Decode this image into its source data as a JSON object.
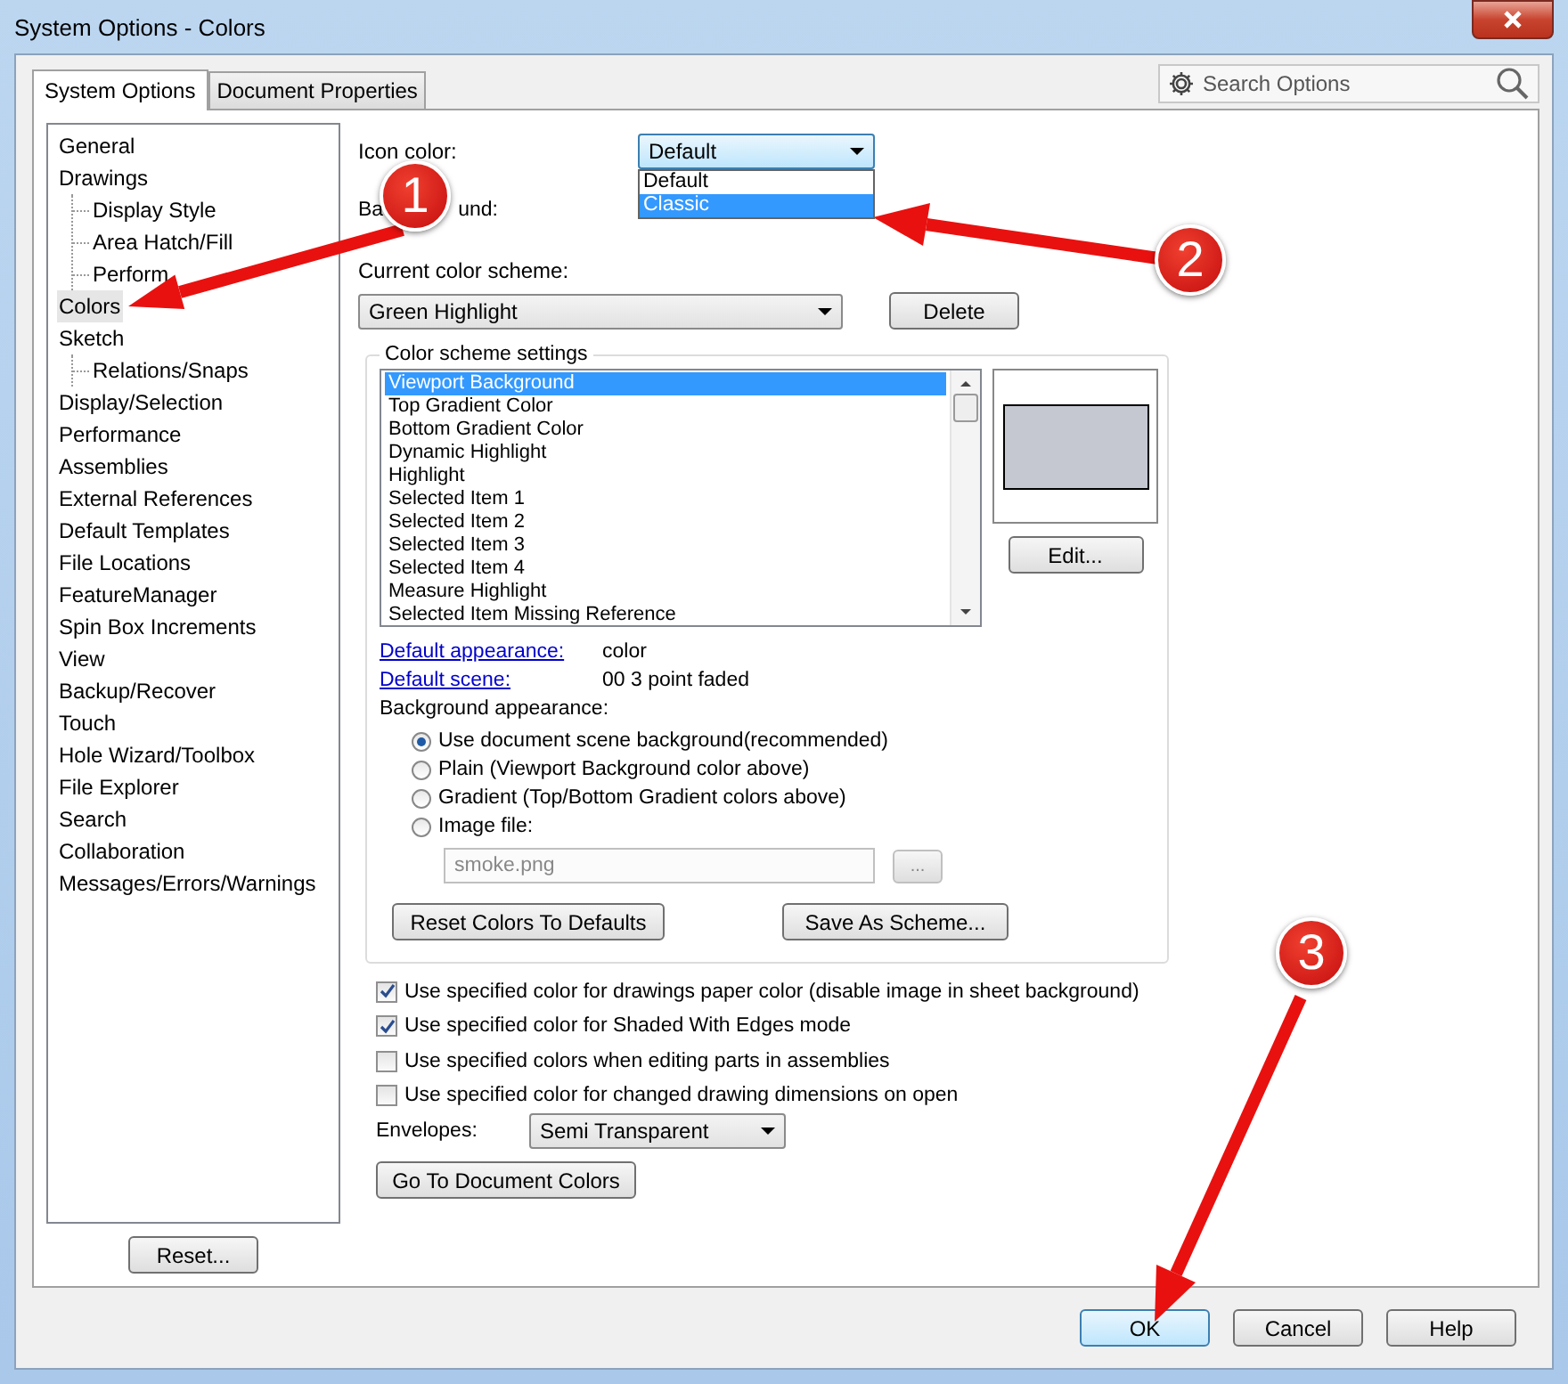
{
  "window": {
    "title": "System Options - Colors"
  },
  "tabs": [
    {
      "label": "System Options",
      "selected": true
    },
    {
      "label": "Document Properties",
      "selected": false
    }
  ],
  "search": {
    "placeholder": "Search Options"
  },
  "tree": [
    {
      "label": "General",
      "selected": false
    },
    {
      "label": "Drawings",
      "selected": false,
      "children": [
        {
          "label": "Display Style",
          "selected": false
        },
        {
          "label": "Area Hatch/Fill",
          "selected": false
        },
        {
          "label": "Perform",
          "selected": false
        }
      ]
    },
    {
      "label": "Colors",
      "selected": true
    },
    {
      "label": "Sketch",
      "selected": false,
      "children": [
        {
          "label": "Relations/Snaps",
          "selected": false
        }
      ]
    },
    {
      "label": "Display/Selection",
      "selected": false
    },
    {
      "label": "Performance",
      "selected": false
    },
    {
      "label": "Assemblies",
      "selected": false
    },
    {
      "label": "External References",
      "selected": false
    },
    {
      "label": "Default Templates",
      "selected": false
    },
    {
      "label": "File Locations",
      "selected": false
    },
    {
      "label": "FeatureManager",
      "selected": false
    },
    {
      "label": "Spin Box Increments",
      "selected": false
    },
    {
      "label": "View",
      "selected": false
    },
    {
      "label": "Backup/Recover",
      "selected": false
    },
    {
      "label": "Touch",
      "selected": false
    },
    {
      "label": "Hole Wizard/Toolbox",
      "selected": false
    },
    {
      "label": "File Explorer",
      "selected": false
    },
    {
      "label": "Search",
      "selected": false
    },
    {
      "label": "Collaboration",
      "selected": false
    },
    {
      "label": "Messages/Errors/Warnings",
      "selected": false
    }
  ],
  "reset_button": "Reset...",
  "icon_color": {
    "label": "Icon color:",
    "value": "Default",
    "options": [
      {
        "label": "Default",
        "highlighted": false
      },
      {
        "label": "Classic",
        "highlighted": true
      }
    ]
  },
  "background": {
    "label_parts": [
      "Ba",
      "und:"
    ]
  },
  "color_scheme": {
    "label": "Current color scheme:",
    "value": "Green Highlight",
    "delete_button": "Delete"
  },
  "scheme_settings": {
    "title": "Color scheme settings",
    "items": [
      {
        "label": "Viewport Background",
        "selected": true
      },
      {
        "label": "Top Gradient Color",
        "selected": false
      },
      {
        "label": "Bottom Gradient Color",
        "selected": false
      },
      {
        "label": "Dynamic Highlight",
        "selected": false
      },
      {
        "label": "Highlight",
        "selected": false
      },
      {
        "label": "Selected Item 1",
        "selected": false
      },
      {
        "label": "Selected Item 2",
        "selected": false
      },
      {
        "label": "Selected Item 3",
        "selected": false
      },
      {
        "label": "Selected Item 4",
        "selected": false
      },
      {
        "label": "Measure Highlight",
        "selected": false
      },
      {
        "label": "Selected Item Missing Reference",
        "selected": false
      }
    ],
    "edit_button": "Edit...",
    "default_appearance": {
      "link": "Default appearance:",
      "value": "color"
    },
    "default_scene": {
      "link": "Default scene:",
      "value": "00 3 point faded"
    },
    "background_appearance": {
      "label": "Background appearance:",
      "options": [
        {
          "label": "Use document scene background(recommended)",
          "selected": true
        },
        {
          "label": "Plain (Viewport Background color above)",
          "selected": false
        },
        {
          "label": "Gradient (Top/Bottom Gradient colors above)",
          "selected": false
        },
        {
          "label": "Image file:",
          "selected": false
        }
      ]
    },
    "image_file": {
      "value": "smoke.png",
      "disabled": true,
      "browse_button": "..."
    },
    "reset_colors_button": "Reset Colors To Defaults",
    "save_scheme_button": "Save As Scheme..."
  },
  "checkboxes": [
    {
      "label": "Use specified color for drawings paper color (disable image in sheet background)",
      "checked": true
    },
    {
      "label": "Use specified color for Shaded With Edges mode",
      "checked": true
    },
    {
      "label": "Use specified colors when editing parts in assemblies",
      "checked": false
    },
    {
      "label": "Use specified color for changed drawing dimensions on open",
      "checked": false
    }
  ],
  "envelopes": {
    "label": "Envelopes:",
    "value": "Semi Transparent"
  },
  "go_to_button": "Go To Document Colors",
  "buttons": [
    {
      "label": "OK",
      "default": true
    },
    {
      "label": "Cancel",
      "default": false
    },
    {
      "label": "Help",
      "default": false
    }
  ],
  "annotations": [
    {
      "number": "1"
    },
    {
      "number": "2"
    },
    {
      "number": "3"
    }
  ]
}
